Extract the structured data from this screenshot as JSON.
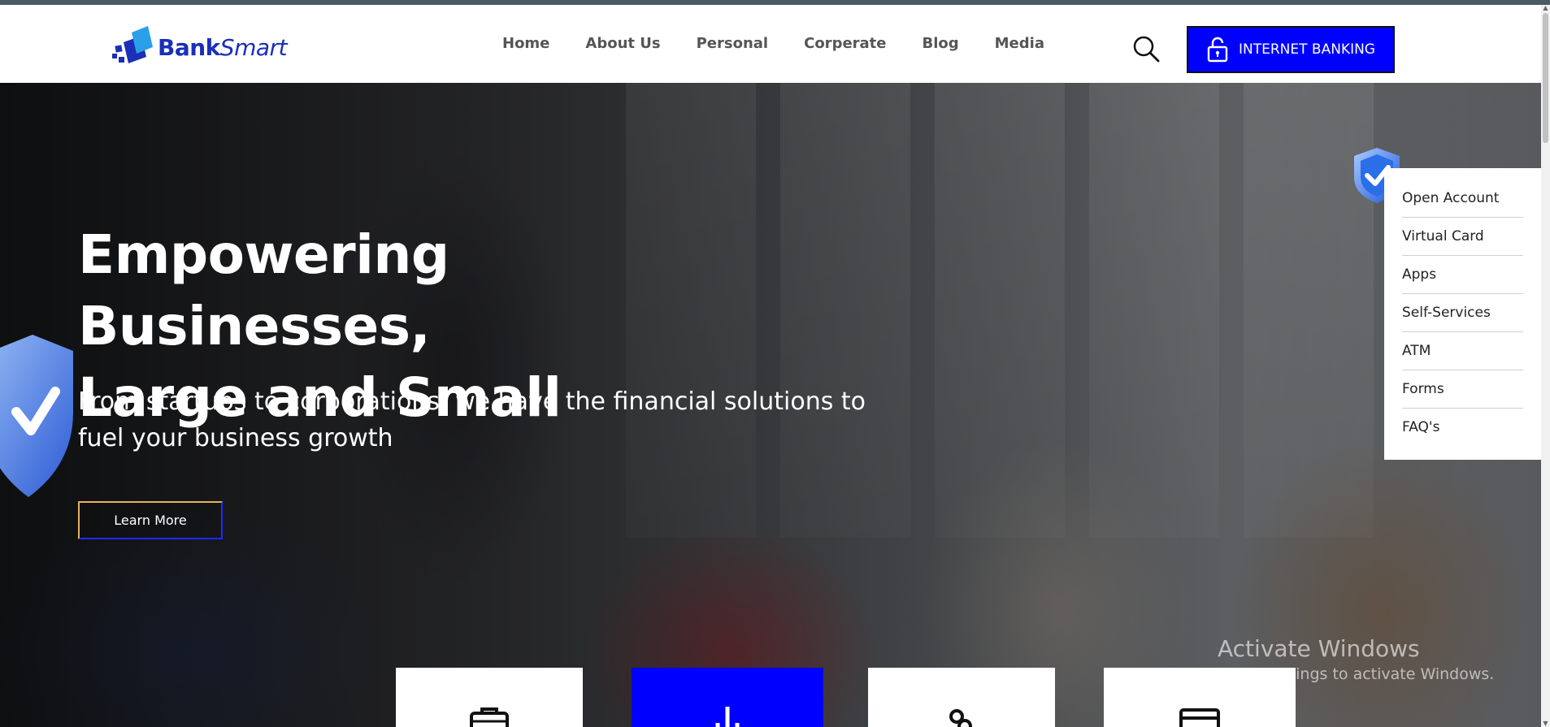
{
  "brand": {
    "logo_bold": "Bank",
    "logo_light": "Smart",
    "accent_color": "#0000ff",
    "logo_color": "#1b2fb8"
  },
  "nav": {
    "items": [
      {
        "label": "Home"
      },
      {
        "label": "About Us"
      },
      {
        "label": "Personal"
      },
      {
        "label": "Corperate"
      },
      {
        "label": "Blog"
      },
      {
        "label": "Media"
      }
    ],
    "search_icon": "search-icon"
  },
  "internet_banking": {
    "label": "INTERNET BANKING",
    "icon": "unlock-icon"
  },
  "hero": {
    "title_line1": "Empowering Businesses,",
    "title_line2": "Large and Small",
    "subtitle_line1": "From startups to corporations, we have the financial solutions to",
    "subtitle_line2": "fuel your business growth",
    "cta_label": "Learn More"
  },
  "side_menu": {
    "icon": "shield-check-icon",
    "items": [
      {
        "label": "Open Account"
      },
      {
        "label": "Virtual Card"
      },
      {
        "label": "Apps"
      },
      {
        "label": "Self-Services"
      },
      {
        "label": "ATM"
      },
      {
        "label": "Forms"
      },
      {
        "label": "FAQ's"
      }
    ]
  },
  "feature_cards": [
    {
      "icon": "briefcase-icon",
      "active": false
    },
    {
      "icon": "chart-icon",
      "active": true
    },
    {
      "icon": "link-icon",
      "active": false
    },
    {
      "icon": "card-icon",
      "active": false
    }
  ],
  "watermark": {
    "line1": "Activate Windows",
    "line2": "Go to Settings to activate Windows."
  }
}
